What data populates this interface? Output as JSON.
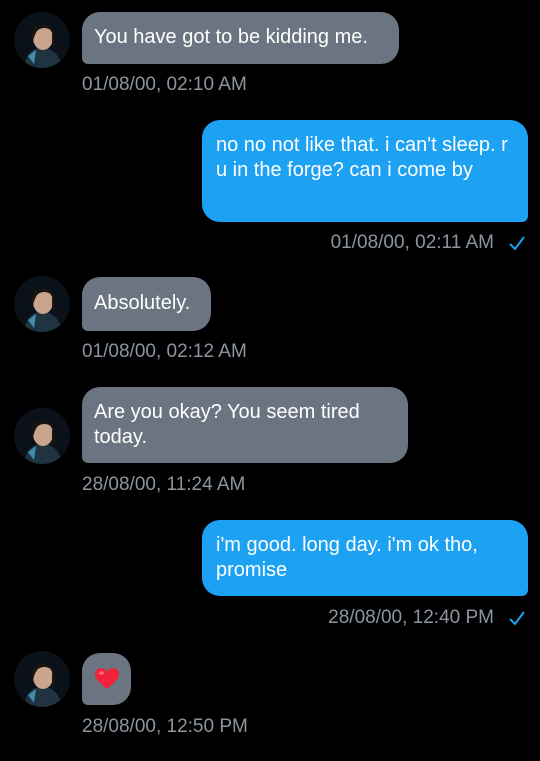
{
  "accent": {
    "outgoing_bubble": "#1da1f2",
    "incoming_bubble": "#6a7581",
    "timestamp": "#8c959f",
    "background": "#000000"
  },
  "messages": [
    {
      "direction": "incoming",
      "text": "You have got to be kidding me.",
      "timestamp": "01/08/00, 02:10 AM"
    },
    {
      "direction": "outgoing",
      "text": "no no not like that. i can't sleep. r u in the forge? can i come by",
      "timestamp": "01/08/00, 02:11 AM",
      "status_icon": "check-icon"
    },
    {
      "direction": "incoming",
      "text": "Absolutely.",
      "timestamp": "01/08/00, 02:12 AM"
    },
    {
      "direction": "incoming",
      "text": "Are you okay? You seem tired today.",
      "timestamp": "28/08/00, 11:24 AM"
    },
    {
      "direction": "outgoing",
      "text": "i'm good. long day. i'm ok tho, promise",
      "timestamp": "28/08/00, 12:40 PM",
      "status_icon": "check-icon"
    },
    {
      "direction": "incoming",
      "emoji": "red-heart-icon",
      "timestamp": "28/08/00, 12:50 PM"
    }
  ]
}
